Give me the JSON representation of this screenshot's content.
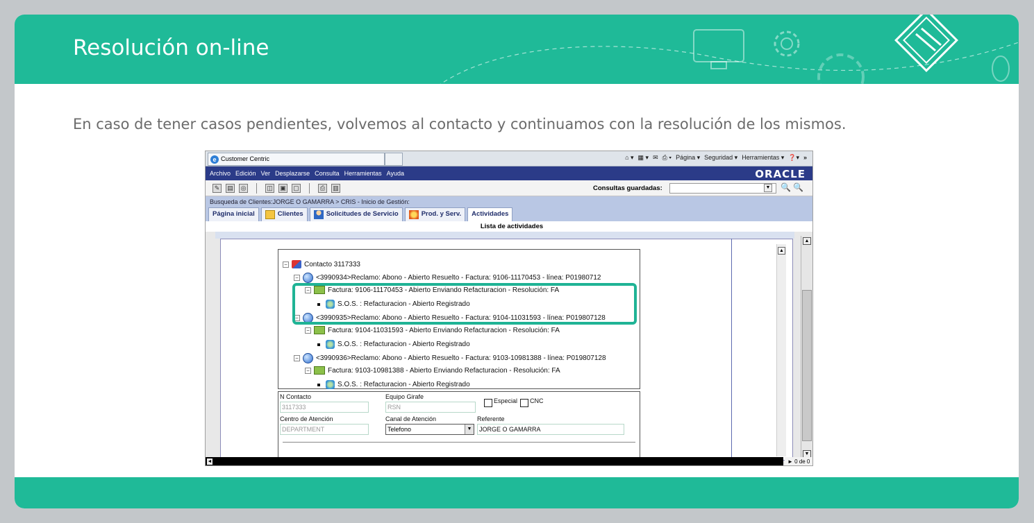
{
  "header": {
    "title": "Resolución on-line"
  },
  "subtitle": "En caso de tener casos pendientes, volvemos al contacto y continuamos con la resolución de los mismos.",
  "browser": {
    "tab_title": "Customer Centric",
    "commands": [
      "Página ▾",
      "Seguridad ▾",
      "Herramientas ▾"
    ],
    "chevron": "»"
  },
  "app": {
    "menu": [
      "Archivo",
      "Edición",
      "Ver",
      "Desplazarse",
      "Consulta",
      "Herramientas",
      "Ayuda"
    ],
    "brand": "ORACLE",
    "saved_queries_label": "Consultas guardadas:",
    "breadcrumb": "Busqueda de Clientes:JORGE O GAMARRA  > CRIS - Inicio de Gestión:",
    "tabs": [
      "Página inicial",
      "Clientes",
      "Solicitudes de Servicio",
      "Prod. y Serv.",
      "Actividades"
    ],
    "activities_title": "Lista de actividades",
    "tree": {
      "contact": "Contacto 3117333",
      "claim1": "<3990934>Reclamo: Abono - Abierto Resuelto - Factura: 9106-11170453 - línea: P01980712",
      "invoice1": "Factura: 9106-11170453 - Abierto Enviando Refacturacion - Resolución: FA",
      "sos1": "S.O.S. : Refacturacion - Abierto Registrado",
      "claim2": "<3990935>Reclamo: Abono - Abierto Resuelto - Factura: 9104-11031593 - línea: P019807128",
      "invoice2": "Factura: 9104-11031593 - Abierto Enviando Refacturacion - Resolución: FA",
      "sos2": "S.O.S. : Refacturacion - Abierto Registrado",
      "claim3": "<3990936>Reclamo: Abono - Abierto Resuelto - Factura: 9103-10981388 - línea: P019807128",
      "invoice3": "Factura: 9103-10981388 - Abierto Enviando Refacturacion - Resolución: FA",
      "sos3": "S.O.S. : Refacturacion - Abierto Registrado"
    },
    "form": {
      "contact_label": "N Contacto",
      "contact_value": "3117333",
      "team_label": "Equipo Girafe",
      "team_value": "RSN",
      "special_label": "Especial",
      "cnc_label": "CNC",
      "center_label": "Centro de Atención",
      "center_value": "DEPARTMENT",
      "channel_label": "Canal de Atención",
      "channel_value": "Telefono",
      "referent_label": "Referente",
      "referent_value": "JORGE O GAMARRA"
    },
    "pager": "0 de 0"
  },
  "colors": {
    "accent": "#1fba98",
    "menu": "#2b3b88",
    "highlight": "#1fb395"
  }
}
